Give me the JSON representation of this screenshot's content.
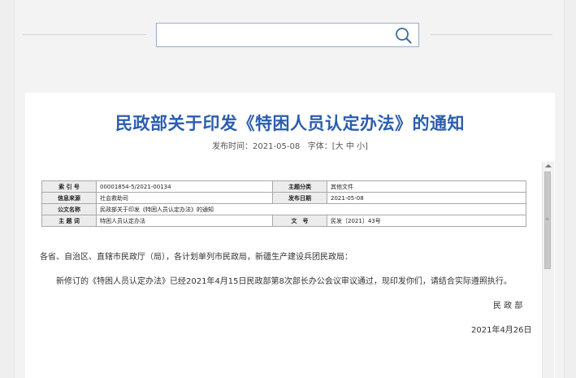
{
  "search": {
    "value": "",
    "placeholder": ""
  },
  "article": {
    "title": "民政部关于印发《特困人员认定办法》的通知",
    "publish_label": "发布时间：2021-05-08",
    "font_label": "字体：",
    "font_open": "[",
    "font_large": "大",
    "font_medium": "中",
    "font_small": "小",
    "font_close": "]"
  },
  "info_table": {
    "index_no_label": "索 引 号",
    "index_no": "00001854-5/2021-00134",
    "subject_label": "主题分类",
    "subject": "其他文件",
    "source_label": "信息来源",
    "source": "社会救助司",
    "date_label": "发布日期",
    "date": "2021-05-08",
    "doc_title_label": "公文名称",
    "doc_title": "民政部关于印发《特困人员认定办法》的通知",
    "keywords_label": "主 题 词",
    "keywords": "特困人员认定办法",
    "doc_no_label": "文　号",
    "doc_no": "民发〔2021〕43号"
  },
  "body": {
    "salutation": "各省、自治区、直辖市民政厅（局），各计划单列市民政局，新疆生产建设兵团民政局：",
    "paragraph": "新修订的《特困人员认定办法》已经2021年4月15日民政部第8次部长办公会议审议通过，现印发你们，请结合实际遵照执行。",
    "signature": "民 政 部",
    "date": "2021年4月26日"
  }
}
